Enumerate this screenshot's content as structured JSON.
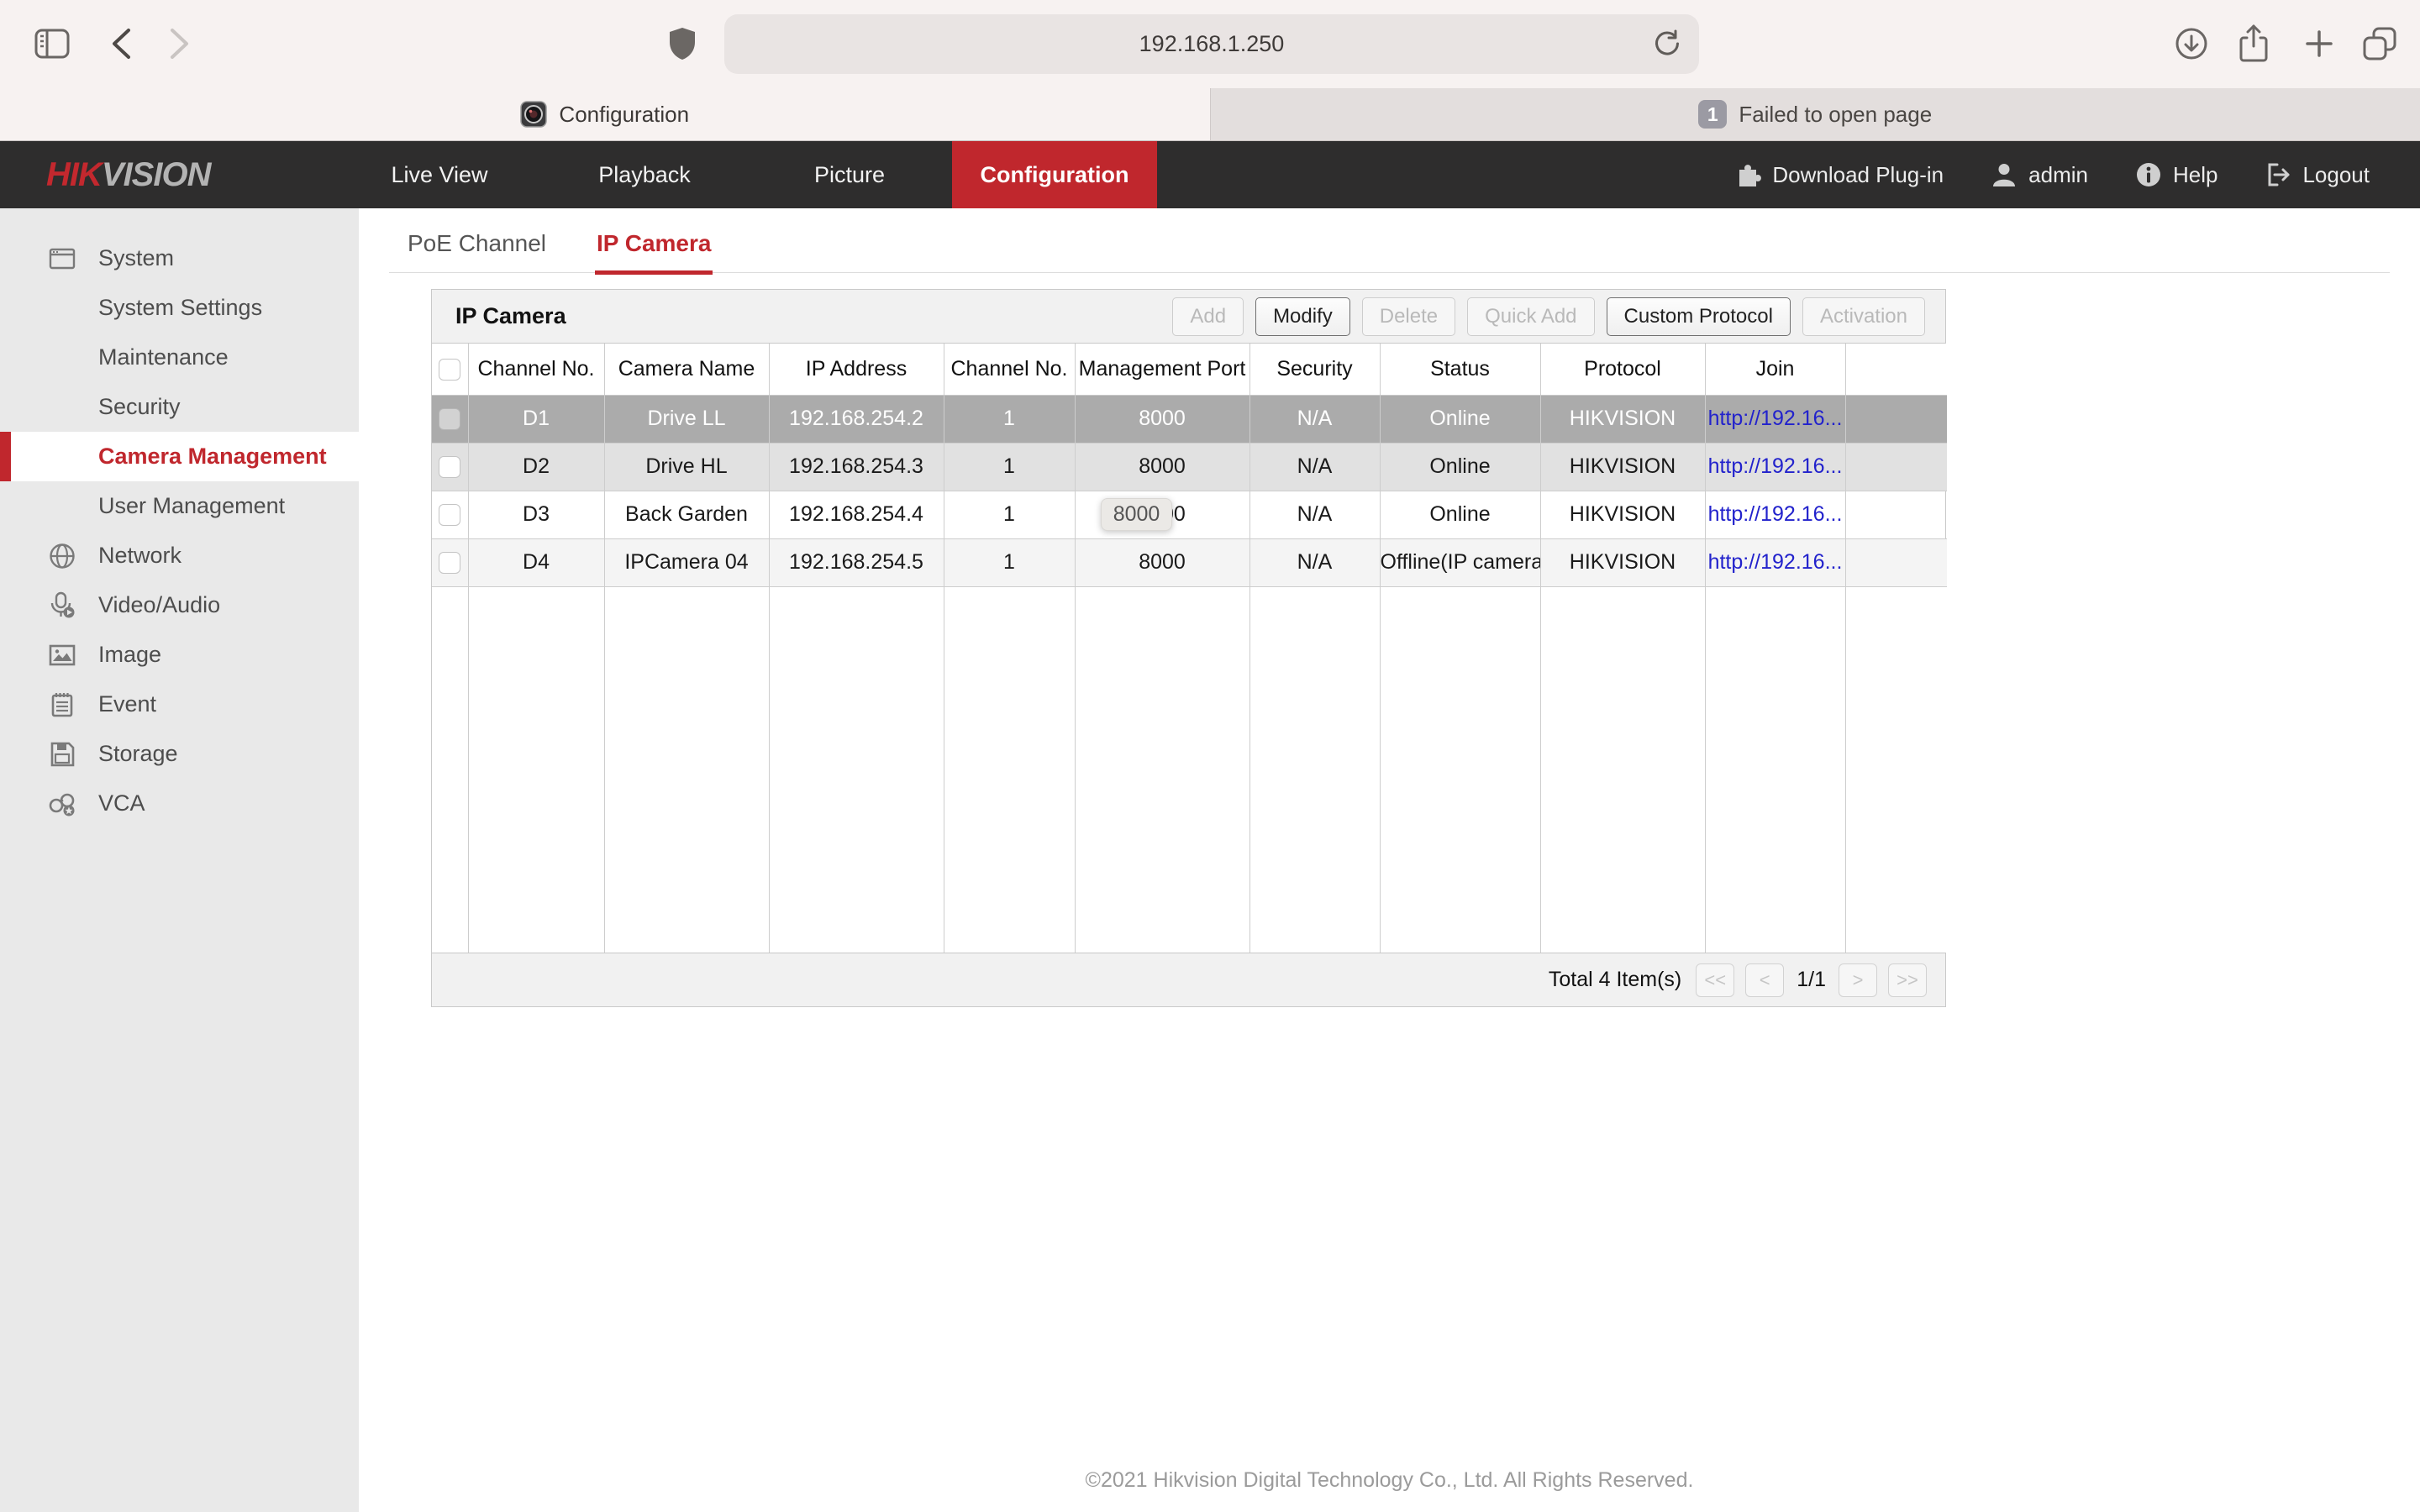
{
  "browser": {
    "url": "192.168.1.250",
    "tabs": [
      {
        "title": "Configuration",
        "active": true
      },
      {
        "title": "Failed to open page",
        "badge": "1",
        "active": false
      }
    ]
  },
  "site_header": {
    "brand": {
      "part1": "HIK",
      "part2": "VISION"
    },
    "nav": [
      {
        "label": "Live View",
        "active": false
      },
      {
        "label": "Playback",
        "active": false
      },
      {
        "label": "Picture",
        "active": false
      },
      {
        "label": "Configuration",
        "active": true
      }
    ],
    "actions": [
      {
        "label": "Download Plug-in",
        "icon": "plugin-icon"
      },
      {
        "label": "admin",
        "icon": "user-icon"
      },
      {
        "label": "Help",
        "icon": "info-icon"
      },
      {
        "label": "Logout",
        "icon": "logout-icon"
      }
    ]
  },
  "sidebar": {
    "items": [
      {
        "label": "System",
        "icon": "system-icon",
        "level": 1,
        "active": false
      },
      {
        "label": "System Settings",
        "level": 2,
        "active": false
      },
      {
        "label": "Maintenance",
        "level": 2,
        "active": false
      },
      {
        "label": "Security",
        "level": 2,
        "active": false
      },
      {
        "label": "Camera Management",
        "level": 2,
        "active": true
      },
      {
        "label": "User Management",
        "level": 2,
        "active": false
      },
      {
        "label": "Network",
        "icon": "network-icon",
        "level": 1,
        "active": false
      },
      {
        "label": "Video/Audio",
        "icon": "video-audio-icon",
        "level": 1,
        "active": false
      },
      {
        "label": "Image",
        "icon": "image-icon",
        "level": 1,
        "active": false
      },
      {
        "label": "Event",
        "icon": "event-icon",
        "level": 1,
        "active": false
      },
      {
        "label": "Storage",
        "icon": "storage-icon",
        "level": 1,
        "active": false
      },
      {
        "label": "VCA",
        "icon": "vca-icon",
        "level": 1,
        "active": false
      }
    ]
  },
  "content": {
    "tabs": [
      {
        "label": "PoE Channel",
        "active": false
      },
      {
        "label": "IP Camera",
        "active": true
      }
    ],
    "panel": {
      "title": "IP Camera",
      "buttons": [
        {
          "label": "Add",
          "enabled": false
        },
        {
          "label": "Modify",
          "enabled": true
        },
        {
          "label": "Delete",
          "enabled": false
        },
        {
          "label": "Quick Add",
          "enabled": false
        },
        {
          "label": "Custom Protocol",
          "enabled": true
        },
        {
          "label": "Activation",
          "enabled": false
        }
      ],
      "table": {
        "columns": [
          "",
          "Channel No.",
          "Camera Name",
          "IP Address",
          "Channel No.",
          "Management Port",
          "Security",
          "Status",
          "Protocol",
          "Join",
          ""
        ],
        "rows": [
          {
            "channel_no": "D1",
            "camera_name": "Drive LL",
            "ip_address": "192.168.254.2",
            "channel": "1",
            "management_port": "8000",
            "security": "N/A",
            "status": "Online",
            "protocol": "HIKVISION",
            "join": "http://192.16...",
            "selected": true
          },
          {
            "channel_no": "D2",
            "camera_name": "Drive HL",
            "ip_address": "192.168.254.3",
            "channel": "1",
            "management_port": "8000",
            "security": "N/A",
            "status": "Online",
            "protocol": "HIKVISION",
            "join": "http://192.16...",
            "selected": false
          },
          {
            "channel_no": "D3",
            "camera_name": "Back Garden",
            "ip_address": "192.168.254.4",
            "channel": "1",
            "management_port": "8000",
            "security": "N/A",
            "status": "Online",
            "protocol": "HIKVISION",
            "join": "http://192.16...",
            "selected": false
          },
          {
            "channel_no": "D4",
            "camera_name": "IPCamera 04",
            "ip_address": "192.168.254.5",
            "channel": "1",
            "management_port": "8000",
            "security": "N/A",
            "status": "Offline(IP camera...",
            "protocol": "HIKVISION",
            "join": "http://192.16...",
            "selected": false
          }
        ]
      },
      "tooltip": {
        "text": "8000"
      },
      "footer": {
        "total": "Total 4 Item(s)",
        "page_indicator": "1/1",
        "pager": {
          "first": "<<",
          "prev": "<",
          "next": ">",
          "last": ">>"
        }
      }
    },
    "copyright": "©2021 Hikvision Digital Technology Co., Ltd. All Rights Reserved."
  },
  "colors": {
    "accent_red": "#c0272d",
    "header_bg": "#2e2d2d",
    "link_blue": "#2222cc",
    "selected_row_bg": "#ababab",
    "sidebar_bg": "#e9e9e9",
    "chrome_bg": "#f7f2f1"
  }
}
